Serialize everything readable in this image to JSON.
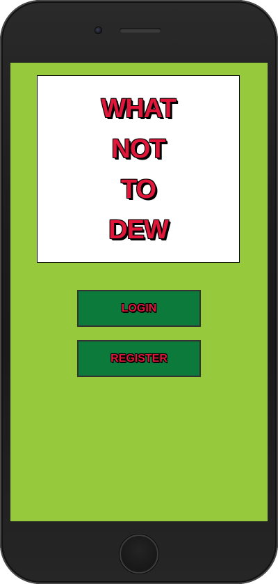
{
  "app": {
    "title_lines": [
      "WHAT",
      "NOT",
      "TO",
      "DEW"
    ]
  },
  "buttons": {
    "login_label": "LOGIN",
    "register_label": "REGISTER"
  },
  "colors": {
    "screen_background": "#97c93d",
    "title_text": "#e0163a",
    "button_background": "#0b7a3b",
    "phone_body": "#1c1c1c"
  },
  "icons": {
    "camera": "front-camera-icon",
    "speaker": "earpiece-speaker-icon",
    "home": "home-button-icon"
  }
}
